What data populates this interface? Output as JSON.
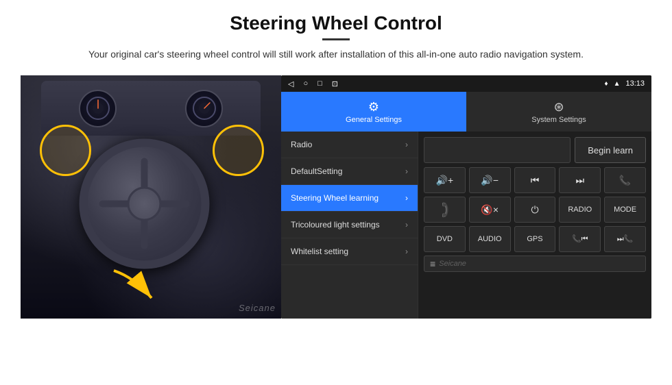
{
  "page": {
    "title": "Steering Wheel Control",
    "divider": true,
    "subtitle": "Your original car's steering wheel control will still work after installation of this all-in-one auto radio navigation system."
  },
  "android": {
    "statusBar": {
      "time": "13:13",
      "icons": [
        "◁",
        "○",
        "□",
        "⊡"
      ]
    },
    "tabs": [
      {
        "id": "general",
        "label": "General Settings",
        "active": true
      },
      {
        "id": "system",
        "label": "System Settings",
        "active": false
      }
    ],
    "menu": [
      {
        "id": "radio",
        "label": "Radio",
        "active": false
      },
      {
        "id": "default",
        "label": "DefaultSetting",
        "active": false
      },
      {
        "id": "steering",
        "label": "Steering Wheel learning",
        "active": true
      },
      {
        "id": "tricoloured",
        "label": "Tricoloured light settings",
        "active": false
      },
      {
        "id": "whitelist",
        "label": "Whitelist setting",
        "active": false
      }
    ],
    "rightPanel": {
      "beginLearnBtn": "Begin learn",
      "controlButtons": [
        {
          "id": "vol-up",
          "label": "🔊+",
          "type": "icon"
        },
        {
          "id": "vol-down",
          "label": "🔊−",
          "type": "icon"
        },
        {
          "id": "prev-track",
          "label": "⏮",
          "type": "icon"
        },
        {
          "id": "next-track",
          "label": "⏭",
          "type": "icon"
        },
        {
          "id": "phone",
          "label": "📞",
          "type": "icon"
        },
        {
          "id": "hang-up",
          "label": "↙",
          "type": "icon"
        },
        {
          "id": "mute",
          "label": "🔇×",
          "type": "icon"
        },
        {
          "id": "power",
          "label": "⏻",
          "type": "icon"
        },
        {
          "id": "radio-btn",
          "label": "RADIO",
          "type": "text"
        },
        {
          "id": "mode-btn",
          "label": "MODE",
          "type": "text"
        },
        {
          "id": "dvd-btn",
          "label": "DVD",
          "type": "text"
        },
        {
          "id": "audio-btn",
          "label": "AUDIO",
          "type": "text"
        },
        {
          "id": "gps-btn",
          "label": "GPS",
          "type": "text"
        },
        {
          "id": "phone2-btn",
          "label": "📞⏮",
          "type": "icon"
        },
        {
          "id": "skip-btn",
          "label": "⏭📞",
          "type": "icon"
        }
      ]
    }
  }
}
